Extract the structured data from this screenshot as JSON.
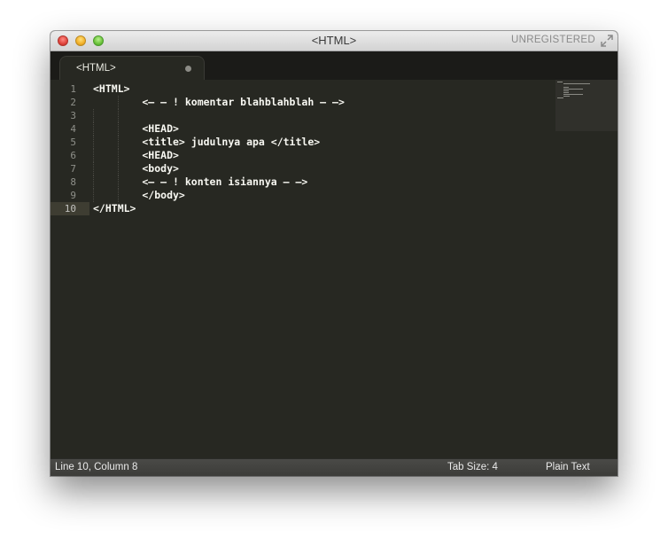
{
  "window": {
    "title": "<HTML>",
    "unregistered": "UNREGISTERED"
  },
  "tab": {
    "label": "<HTML>"
  },
  "editor": {
    "lines": [
      {
        "number": "1",
        "text": "<HTML>"
      },
      {
        "number": "2",
        "text": "        <– – ! komentar blahblahblah – –>"
      },
      {
        "number": "3",
        "text": ""
      },
      {
        "number": "4",
        "text": "        <HEAD>"
      },
      {
        "number": "5",
        "text": "        <title> judulnya apa </title>"
      },
      {
        "number": "6",
        "text": "        <HEAD>"
      },
      {
        "number": "7",
        "text": "        <body>"
      },
      {
        "number": "8",
        "text": "        <– – ! konten isiannya – –>"
      },
      {
        "number": "9",
        "text": "        </body>"
      },
      {
        "number": "10",
        "text": "</HTML>"
      }
    ],
    "active_line": 10
  },
  "status": {
    "position": "Line 10, Column 8",
    "tab_size": "Tab Size: 4",
    "syntax": "Plain Text"
  },
  "icons": {
    "close": "close-traffic-light-icon",
    "minimize": "minimize-traffic-light-icon",
    "zoom": "zoom-traffic-light-icon",
    "fullscreen": "fullscreen-arrows-icon",
    "tab_modified": "unsaved-dot-icon"
  },
  "colors": {
    "editor_background": "#272822",
    "text": "#f8f8f2",
    "line_number": "#8f908a",
    "active_line_highlight": "#3e3d32"
  }
}
